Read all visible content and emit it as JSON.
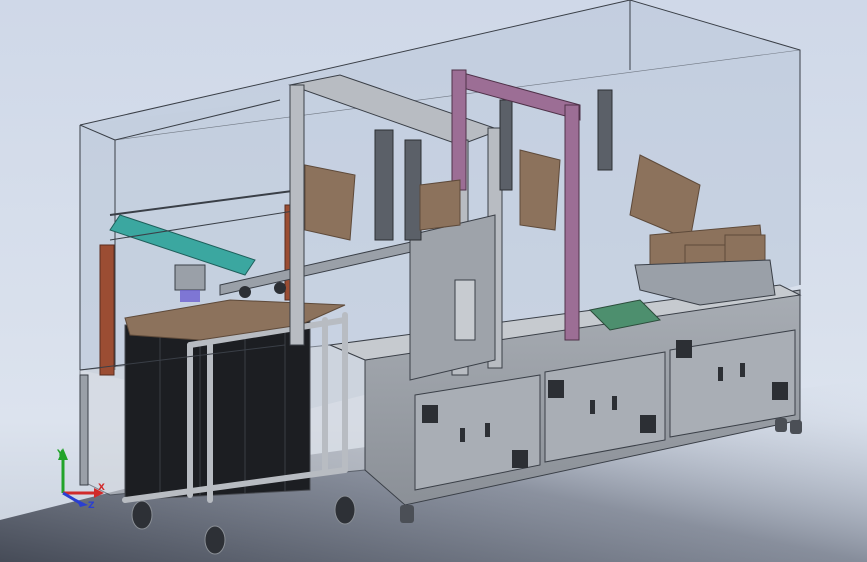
{
  "viewport": {
    "background_top": "#cdd6e6",
    "background_bottom": "#dfe6f0",
    "floor_shadow": "#3c4250"
  },
  "colors": {
    "enclosure_glass": "#b9c6d8",
    "enclosure_edge": "#3a3f47",
    "cabinet_body": "#9ea3aa",
    "cabinet_door": "#a9aeb5",
    "frame_steel": "#b8bcc2",
    "accent_purple": "#9c6e95",
    "accent_teal": "#3ba7a0",
    "accent_rust": "#9b4d33",
    "cardboard": "#8c725c",
    "dark_stack": "#1c1e22"
  },
  "triad": {
    "x_label": "X",
    "y_label": "Y",
    "z_label": "Z",
    "x_color": "#d12b2b",
    "y_color": "#22a32a",
    "z_color": "#2a3fd1"
  }
}
